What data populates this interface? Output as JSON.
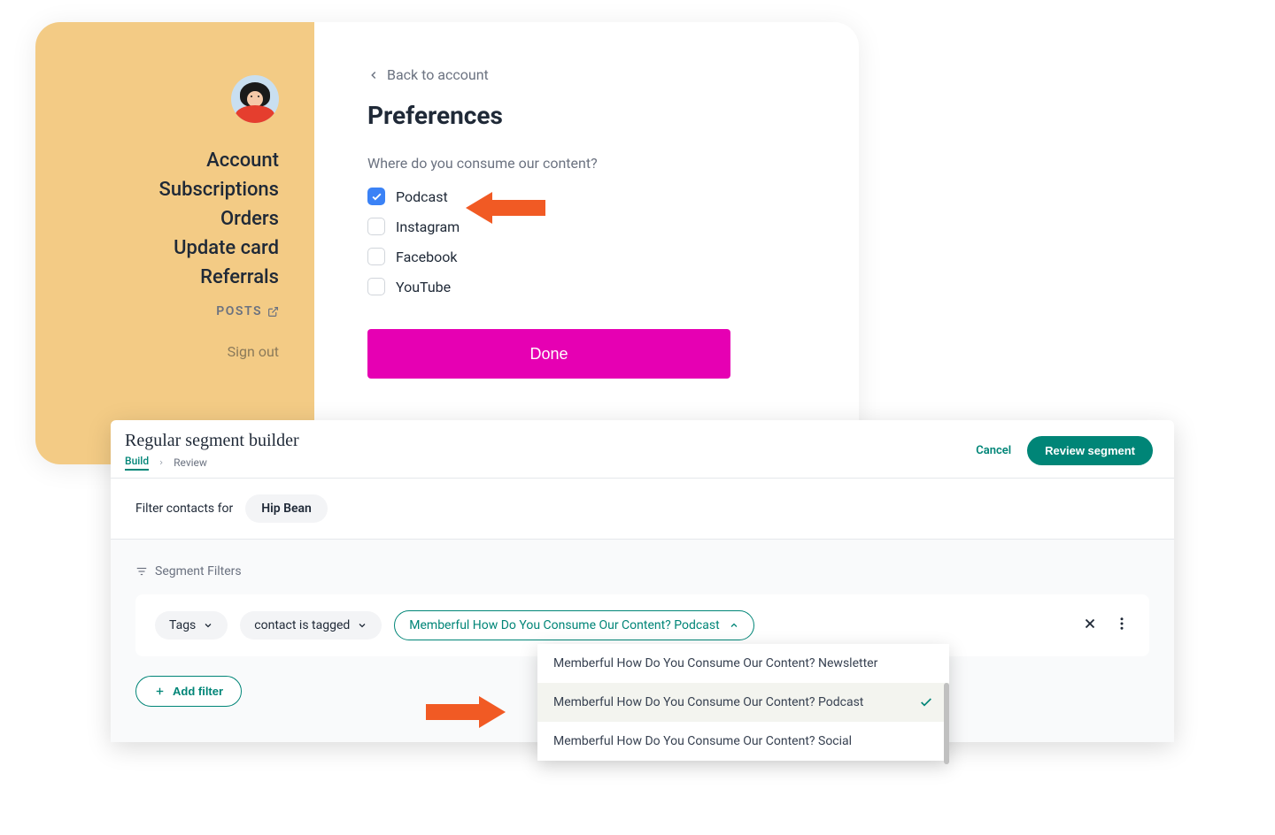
{
  "sidebar": {
    "nav": [
      "Account",
      "Subscriptions",
      "Orders",
      "Update card",
      "Referrals"
    ],
    "posts_label": "POSTS",
    "signout_label": "Sign out"
  },
  "main": {
    "back_label": "Back to account",
    "title": "Preferences",
    "question": "Where do you consume our content?",
    "options": [
      {
        "label": "Podcast",
        "checked": true
      },
      {
        "label": "Instagram",
        "checked": false
      },
      {
        "label": "Facebook",
        "checked": false
      },
      {
        "label": "YouTube",
        "checked": false
      }
    ],
    "done_label": "Done"
  },
  "segment": {
    "title": "Regular segment builder",
    "breadcrumb": {
      "active": "Build",
      "next": "Review"
    },
    "cancel_label": "Cancel",
    "review_label": "Review segment",
    "filter_for_label": "Filter contacts for",
    "audience_name": "Hip Bean",
    "filters_label": "Segment Filters",
    "filter_row": {
      "tags_label": "Tags",
      "condition_label": "contact is tagged",
      "value_label": "Memberful How Do You Consume Our Content? Podcast"
    },
    "dropdown_options": [
      {
        "label": "Memberful How Do You Consume Our Content? Newsletter",
        "selected": false
      },
      {
        "label": "Memberful How Do You Consume Our Content? Podcast",
        "selected": true
      },
      {
        "label": "Memberful How Do You Consume Our Content? Social",
        "selected": false
      }
    ],
    "add_filter_label": "Add filter"
  },
  "colors": {
    "accent_pink": "#e600b3",
    "accent_teal": "#008577",
    "sidebar_bg": "#f3cb85",
    "checkbox_blue": "#3b82f6",
    "arrow_orange": "#f15a24"
  }
}
